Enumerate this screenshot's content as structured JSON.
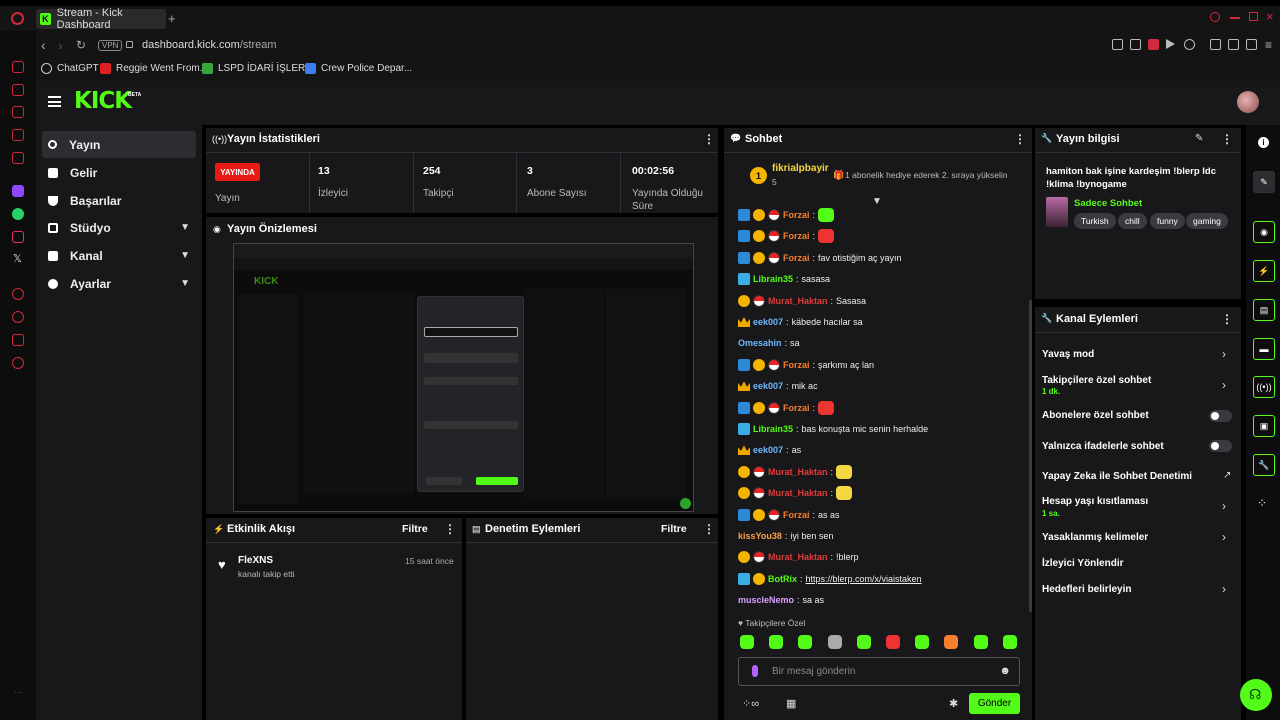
{
  "browser": {
    "tab_title": "Stream - Kick Dashboard",
    "new_tab": "+",
    "url_prefix": "dashboard.kick.com",
    "url_path": "/stream",
    "vpn": "VPN",
    "bookmarks": [
      "ChatGPT",
      "Reggie Went From...",
      "LSPD İDARİ İŞLER...",
      "Crew Police Depar..."
    ],
    "bookmark_colors": [
      "#cccccc",
      "#e02020",
      "#3ba640",
      "#3d7cf0"
    ]
  },
  "kick": {
    "logo": "KICK",
    "beta": "BETA"
  },
  "nav": {
    "items": [
      {
        "label": "Yayın",
        "active": true,
        "has_chevron": false
      },
      {
        "label": "Gelir",
        "active": false,
        "has_chevron": false
      },
      {
        "label": "Başarılar",
        "active": false,
        "has_chevron": false
      },
      {
        "label": "Stüdyo",
        "active": false,
        "has_chevron": true
      },
      {
        "label": "Kanal",
        "active": false,
        "has_chevron": true
      },
      {
        "label": "Ayarlar",
        "active": false,
        "has_chevron": true
      }
    ]
  },
  "stats": {
    "title": "Yayın İstatistikleri",
    "live_badge": "YAYINDA",
    "live_label": "Yayın",
    "items": [
      {
        "value": "13",
        "label": "İzleyici"
      },
      {
        "value": "254",
        "label": "Takipçi"
      },
      {
        "value": "3",
        "label": "Abone Sayısı"
      },
      {
        "value": "00:02:56",
        "label": "Yayında Olduğu Süre"
      }
    ]
  },
  "preview": {
    "title": "Yayın Önizlemesi"
  },
  "activity": {
    "title": "Etkinlik Akışı",
    "filter": "Filtre",
    "event_user": "FleXNS",
    "event_text": "kanalı takip etti",
    "event_time": "15 saat önce"
  },
  "moderation": {
    "title": "Denetim Eylemleri",
    "filter": "Filtre"
  },
  "chat": {
    "title": "Sohbet",
    "pinned_user": "fikrialpbayir",
    "pinned_count": "5",
    "pinned_text": "1 abonelik hediye ederek 2. sıraya yükselin",
    "messages": [
      {
        "user": "Forzai",
        "color": "#f77f2d",
        "badges": [
          "sq",
          "coin",
          "ball"
        ],
        "text": "",
        "emote": "#53fc18"
      },
      {
        "user": "Forzai",
        "color": "#f77f2d",
        "badges": [
          "sq",
          "coin",
          "ball"
        ],
        "text": "",
        "emote": "#e33"
      },
      {
        "user": "Forzai",
        "color": "#f77f2d",
        "badges": [
          "sq",
          "coin",
          "ball"
        ],
        "text": "fav otistiğim aç yayın",
        "emote": ""
      },
      {
        "user": "Librain35",
        "color": "#53fc18",
        "badges": [
          "sq2"
        ],
        "text": "sasasa",
        "emote": ""
      },
      {
        "user": "Murat_Haktan",
        "color": "#e23b3b",
        "badges": [
          "coin",
          "ball"
        ],
        "text": "Sasasa",
        "emote": ""
      },
      {
        "user": "eek007",
        "color": "#6fb7ff",
        "badges": [
          "crown"
        ],
        "text": "käbede hacılar sa",
        "emote": ""
      },
      {
        "user": "Omesahin",
        "color": "#6fb7ff",
        "badges": [],
        "text": "sa",
        "emote": ""
      },
      {
        "user": "Forzai",
        "color": "#f77f2d",
        "badges": [
          "sq",
          "coin",
          "ball"
        ],
        "text": "şarkımı aç lan",
        "emote": ""
      },
      {
        "user": "eek007",
        "color": "#6fb7ff",
        "badges": [
          "crown"
        ],
        "text": "mik ac",
        "emote": ""
      },
      {
        "user": "Forzai",
        "color": "#f77f2d",
        "badges": [
          "sq",
          "coin",
          "ball"
        ],
        "text": "",
        "emote": "#e33"
      },
      {
        "user": "Librain35",
        "color": "#53fc18",
        "badges": [
          "sq2"
        ],
        "text": "bas konuşta mic senin herhalde",
        "emote": ""
      },
      {
        "user": "eek007",
        "color": "#6fb7ff",
        "badges": [
          "crown"
        ],
        "text": "as",
        "emote": ""
      },
      {
        "user": "Murat_Haktan",
        "color": "#e23b3b",
        "badges": [
          "coin",
          "ball"
        ],
        "text": "",
        "emote": "#f5d742"
      },
      {
        "user": "Murat_Haktan",
        "color": "#e23b3b",
        "badges": [
          "coin",
          "ball"
        ],
        "text": "",
        "emote": "#f5d742"
      },
      {
        "user": "Forzai",
        "color": "#f77f2d",
        "badges": [
          "sq",
          "coin",
          "ball"
        ],
        "text": "as as",
        "emote": ""
      },
      {
        "user": "kissYou38",
        "color": "#f7a14a",
        "badges": [],
        "text": "iyi ben sen",
        "emote": ""
      },
      {
        "user": "Murat_Haktan",
        "color": "#e23b3b",
        "badges": [
          "coin",
          "ball"
        ],
        "text": "!blerp",
        "emote": ""
      },
      {
        "user": "BotRix",
        "color": "#53fc18",
        "badges": [
          "sq2",
          "coin"
        ],
        "text": "https://blerp.com/x/viaistaken",
        "emote": "",
        "link": true
      },
      {
        "user": "muscleNemo",
        "color": "#d8a0ff",
        "badges": [],
        "text": "sa as",
        "emote": ""
      }
    ],
    "followers_only": "Takipçilere Özel",
    "placeholder": "Bir mesaj gönderin",
    "send": "Gönder",
    "emote_colors": [
      "#53fc18",
      "#53fc18",
      "#53fc18",
      "#aaa",
      "#53fc18",
      "#e33",
      "#53fc18",
      "#f77f2d",
      "#53fc18",
      "#53fc18"
    ]
  },
  "stream_info": {
    "title": "Yayın bilgisi",
    "stream_title": "hamiton bak işine kardeşim !blerp ldc !klima !bynogame",
    "category": "Sadece Sohbet",
    "tags": [
      "Turkish",
      "chill",
      "funny",
      "gaming"
    ]
  },
  "channel_actions": {
    "title": "Kanal Eylemleri",
    "items": [
      {
        "label": "Yavaş mod",
        "sub": "",
        "control": "chevron"
      },
      {
        "label": "Takipçilere özel sohbet",
        "sub": "1 dk.",
        "control": "chevron"
      },
      {
        "label": "Abonelere özel sohbet",
        "sub": "",
        "control": "toggle"
      },
      {
        "label": "Yalnızca ifadelerle sohbet",
        "sub": "",
        "control": "toggle"
      },
      {
        "label": "Yapay Zeka ile Sohbet Denetimi",
        "sub": "",
        "control": "external"
      },
      {
        "label": "Hesap yaşı kısıtlaması",
        "sub": "1 sa.",
        "control": "chevron"
      },
      {
        "label": "Yasaklanmış kelimeler",
        "sub": "",
        "control": "chevron"
      },
      {
        "label": "İzleyici Yönlendir",
        "sub": "",
        "control": ""
      },
      {
        "label": "Hedefleri belirleyin",
        "sub": "",
        "control": "chevron"
      }
    ]
  }
}
